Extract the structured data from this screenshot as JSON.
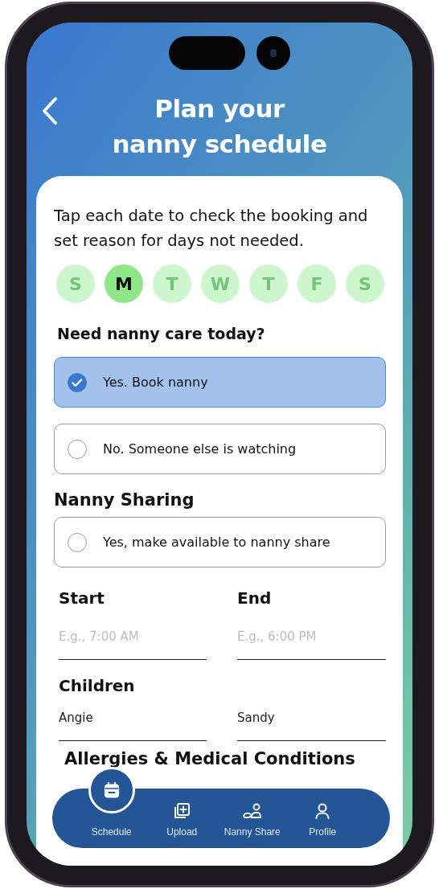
{
  "header": {
    "title": "Plan your\nnanny schedule"
  },
  "instructions": "Tap each date to check the booking and set reason for days not needed.",
  "days": [
    {
      "label": "S",
      "selected": false
    },
    {
      "label": "M",
      "selected": true
    },
    {
      "label": "T",
      "selected": false
    },
    {
      "label": "W",
      "selected": false
    },
    {
      "label": "T",
      "selected": false
    },
    {
      "label": "F",
      "selected": false
    },
    {
      "label": "S",
      "selected": false
    }
  ],
  "care_question": "Need nanny care today?",
  "care_options": [
    {
      "label": "Yes. Book nanny",
      "checked": true
    },
    {
      "label": "No. Someone else is watching",
      "checked": false
    }
  ],
  "sharing_heading": "Nanny Sharing",
  "sharing_options": [
    {
      "label": "Yes, make available to nanny share",
      "checked": false
    }
  ],
  "time_fields": [
    {
      "label": "Start",
      "placeholder": "E.g., 7:00 AM"
    },
    {
      "label": "End",
      "placeholder": "E.g., 6:00 PM"
    }
  ],
  "children_heading": "Children",
  "children": [
    {
      "value": "Angie"
    },
    {
      "value": "Sandy"
    }
  ],
  "allergies_heading": "Allergies & Medical Conditions",
  "nav": [
    {
      "label": "Schedule",
      "kind": "calendar",
      "selected": true
    },
    {
      "label": "Upload",
      "kind": "upload",
      "selected": false
    },
    {
      "label": "Nanny Share",
      "kind": "share",
      "selected": false
    },
    {
      "label": "Profile",
      "kind": "profile",
      "selected": false
    }
  ]
}
